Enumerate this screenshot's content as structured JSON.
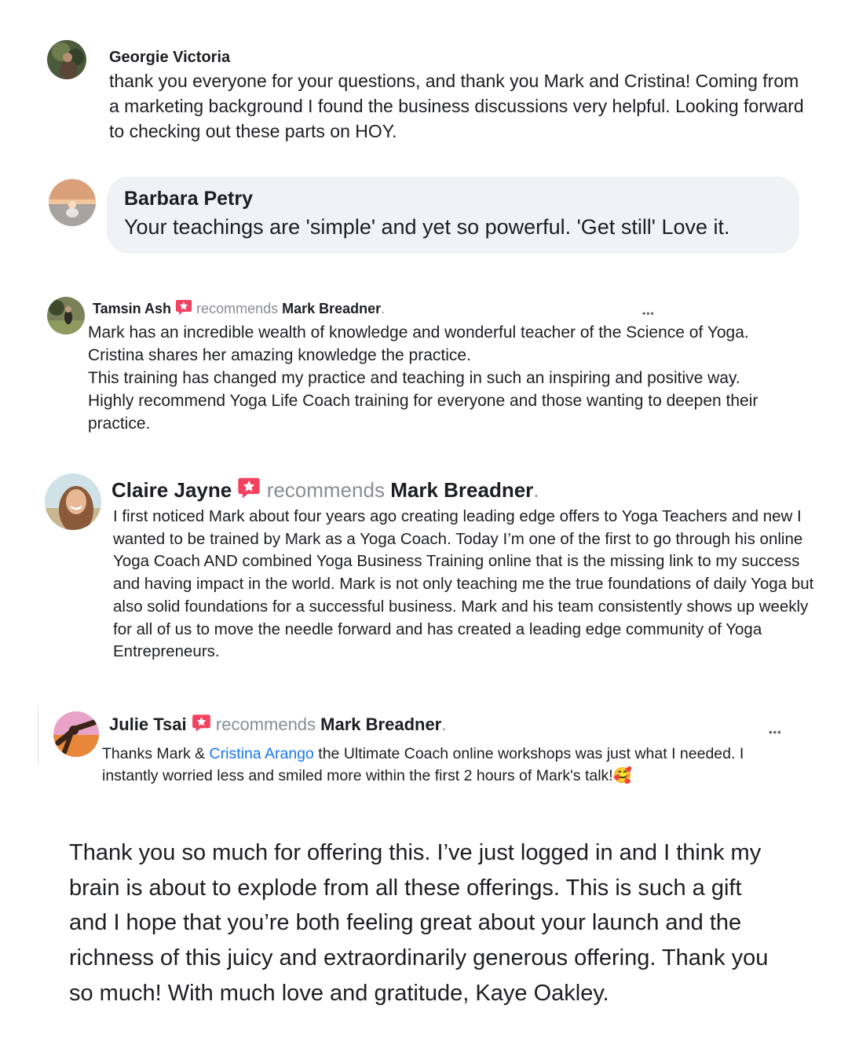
{
  "georgie": {
    "name": "Georgie Victoria",
    "text": "thank you everyone for your questions, and thank you Mark and Cristina! Coming from a marketing background I found the business discussions very helpful. Looking forward to checking out these parts on HOY."
  },
  "barbara": {
    "name": "Barbara Petry",
    "text": "Your teachings are 'simple' and yet so powerful. 'Get still' Love it."
  },
  "tamsin": {
    "name": "Tamsin Ash",
    "recommends": "recommends",
    "target": "Mark Breadner",
    "period": ".",
    "lines": [
      "Mark has an incredible wealth of knowledge and wonderful teacher of the  Science of Yoga.",
      "Cristina shares her amazing knowledge the practice.",
      "This training has changed my practice and teaching in such an inspiring and positive way.",
      "Highly recommend Yoga Life Coach training for everyone and those wanting to deepen their practice."
    ],
    "more": "•••"
  },
  "claire": {
    "name": "Claire Jayne",
    "recommends": "recommends",
    "target": "Mark Breadner",
    "period": ".",
    "text": "I first noticed Mark about four years ago creating leading edge offers to Yoga Teachers and new I wanted to be trained by Mark as a Yoga Coach.  Today I’m one of the first to go through his online Yoga Coach AND combined Yoga Business Training online that is the missing link to my success and having impact in the world.  Mark is not only teaching me the true foundations of daily Yoga but also solid foundations for a successful business. Mark and his team consistently shows up weekly for all of us to move the needle forward and has created a leading edge community of Yoga Entrepreneurs."
  },
  "julie": {
    "name": "Julie Tsai",
    "recommends": "recommends",
    "target": "Mark Breadner",
    "period": ".",
    "text_before": "Thanks Mark & ",
    "mention": "Cristina Arango",
    "text_after": " the Ultimate Coach online workshops was just what I needed. I instantly worried less and smiled more within the first 2 hours of Mark's talk!",
    "emoji": "🥰",
    "more": "•••"
  },
  "kaye": {
    "text": "Thank you so much for offering this.  I’ve just logged in and I think my brain is about to explode from all these offerings.  This is such a gift and I hope that you’re both feeling great about your launch and the richness of this juicy and extraordinarily generous offering.  Thank you so much!  With much love and gratitude, Kaye Oakley."
  },
  "colors": {
    "text": "#1c1e21",
    "muted": "#8a8d91",
    "bubble": "#f0f2f5",
    "link": "#1877f2",
    "recommend_badge": "#f3425f"
  },
  "icons": {
    "recommend": "recommend-badge-icon",
    "more": "more-options-icon"
  }
}
